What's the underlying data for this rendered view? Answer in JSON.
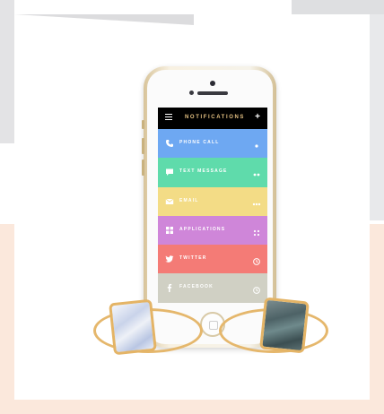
{
  "header": {
    "title": "NOTIFICATIONS",
    "add_symbol": "+"
  },
  "rows": [
    {
      "label": "PHONE CALL",
      "color": "#6ea8f2",
      "icon": "phone-icon",
      "action_icon": "dot-icon"
    },
    {
      "label": "TEXT MESSAGE",
      "color": "#5fdbab",
      "icon": "chat-icon",
      "action_icon": "double-dot-icon"
    },
    {
      "label": "EMAIL",
      "color": "#f3dc86",
      "icon": "mail-icon",
      "action_icon": "triple-dot-icon"
    },
    {
      "label": "APPLICATIONS",
      "color": "#cf86d9",
      "icon": "grid-icon",
      "action_icon": "grid-small-icon"
    },
    {
      "label": "TWITTER",
      "color": "#f47b76",
      "icon": "twitter-icon",
      "action_icon": "clock-icon"
    },
    {
      "label": "FACEBOOK",
      "color": "#d0d0c4",
      "icon": "facebook-icon",
      "action_icon": "clock-icon"
    }
  ]
}
